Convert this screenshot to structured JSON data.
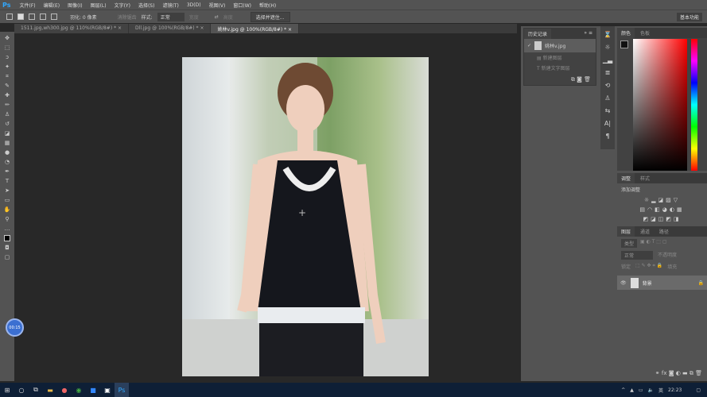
{
  "app": {
    "logo": "Ps"
  },
  "menu": [
    "文件(F)",
    "编辑(E)",
    "图像(I)",
    "图层(L)",
    "文字(Y)",
    "选择(S)",
    "滤镜(T)",
    "3D(D)",
    "视图(V)",
    "窗口(W)",
    "帮助(H)"
  ],
  "options": {
    "feather_label": "羽化: 0 像素",
    "antialias": "消除锯齿",
    "style_label": "样式:",
    "style_value": "正常",
    "width_label": "宽度",
    "height_label": "高度",
    "select_mask": "选择并遮住...",
    "workspace": "基本功能"
  },
  "tabs": [
    {
      "label": "1511.jpg,wh300.jpg @ 110%(RGB/8#) *",
      "active": false
    },
    {
      "label": "Dll.jpg @ 100%(RGB/8#) *",
      "active": false
    },
    {
      "label": "姚林v.jpg @ 100%(RGB/8#) *",
      "active": true
    }
  ],
  "history": {
    "title": "历史记录",
    "snapshot": "姚林v.jpg",
    "items": [
      "新建图层",
      "新建文字图层"
    ]
  },
  "color": {
    "tabs": [
      "颜色",
      "色板"
    ],
    "hue": "#ff0000"
  },
  "adjustments": {
    "tabs": [
      "调整",
      "样式"
    ],
    "add_label": "添加调整"
  },
  "layers": {
    "tabs": [
      "图层",
      "通道",
      "路径"
    ],
    "kind": "类型",
    "mode": "正常",
    "opacity": "不透明度",
    "lock": "锁定",
    "fill": "填充",
    "layer_name": "背景"
  },
  "timer": "00:15",
  "taskbar": {
    "lang": "英",
    "time": "22:23"
  }
}
